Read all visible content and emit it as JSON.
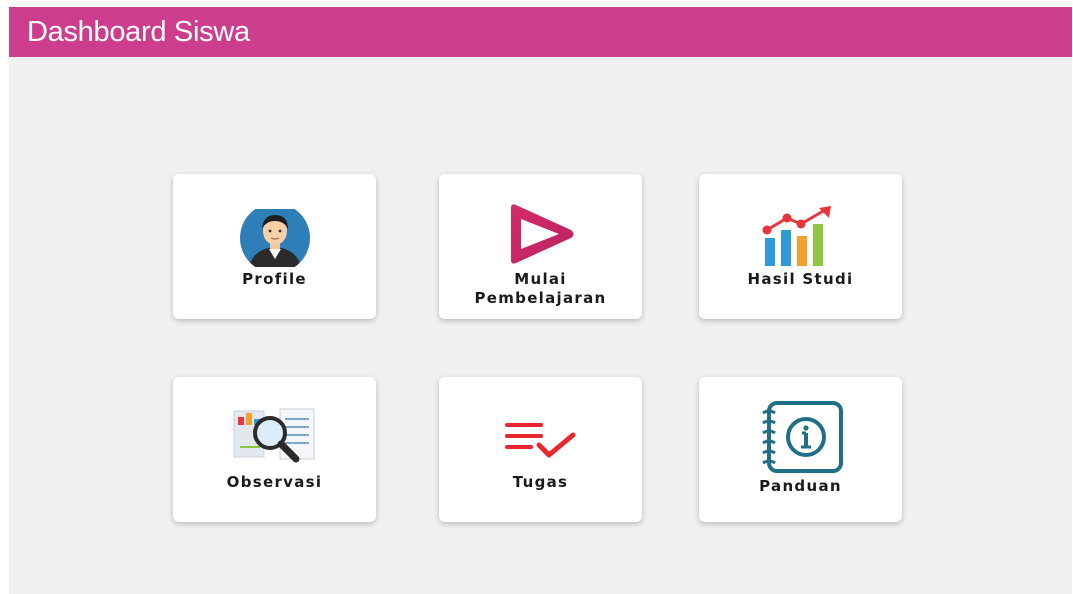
{
  "header": {
    "title": "Dashboard Siswa",
    "background_color": "#cc3d8e"
  },
  "menu": [
    {
      "label": "Profile",
      "icon": "profile-avatar-icon"
    },
    {
      "label": "Mulai\nPembelajaran",
      "icon": "play-icon"
    },
    {
      "label": "Hasil Studi",
      "icon": "bar-chart-icon"
    },
    {
      "label": "Observasi",
      "icon": "magnifier-document-icon"
    },
    {
      "label": "Tugas",
      "icon": "checklist-icon"
    },
    {
      "label": "Panduan",
      "icon": "info-notebook-icon"
    }
  ]
}
